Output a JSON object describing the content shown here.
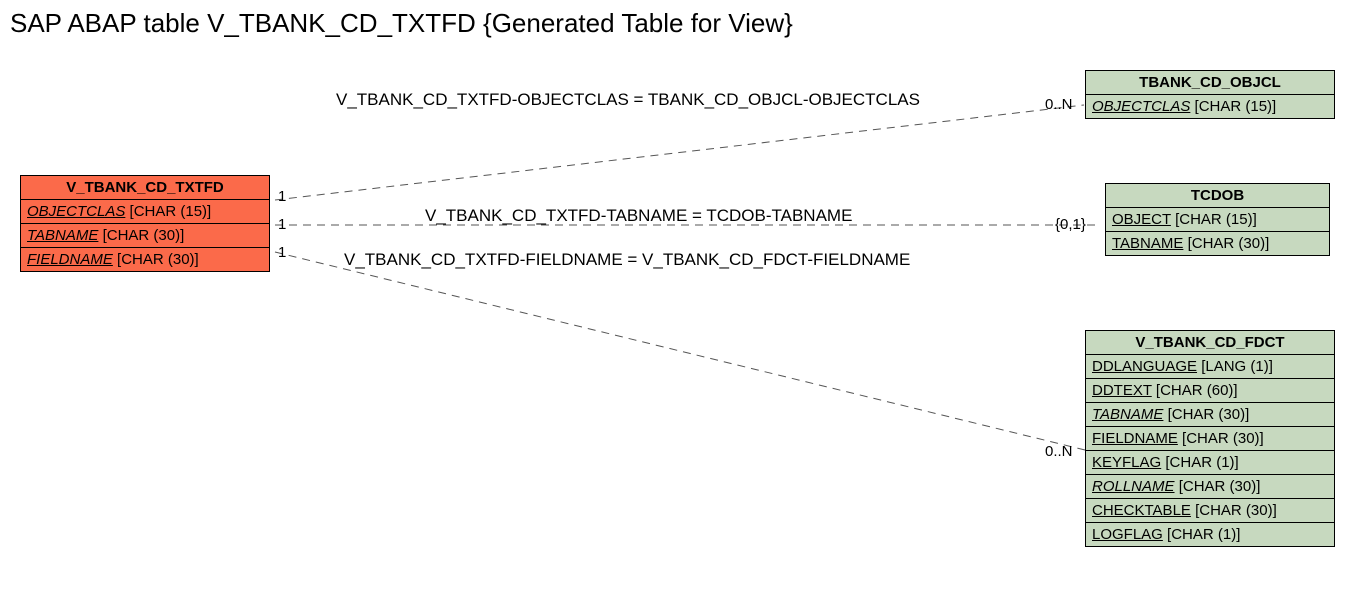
{
  "title": "SAP ABAP table V_TBANK_CD_TXTFD {Generated Table for View}",
  "main": {
    "name": "V_TBANK_CD_TXTFD",
    "fields": [
      {
        "label": "OBJECTCLAS",
        "type": "[CHAR (15)]",
        "italic": true
      },
      {
        "label": "TABNAME",
        "type": "[CHAR (30)]",
        "italic": true
      },
      {
        "label": "FIELDNAME",
        "type": "[CHAR (30)]",
        "italic": true
      }
    ]
  },
  "ref1": {
    "name": "TBANK_CD_OBJCL",
    "fields": [
      {
        "label": "OBJECTCLAS",
        "type": "[CHAR (15)]",
        "italic": true
      }
    ]
  },
  "ref2": {
    "name": "TCDOB",
    "fields": [
      {
        "label": "OBJECT",
        "type": "[CHAR (15)]",
        "italic": false
      },
      {
        "label": "TABNAME",
        "type": "[CHAR (30)]",
        "italic": false
      }
    ]
  },
  "ref3": {
    "name": "V_TBANK_CD_FDCT",
    "fields": [
      {
        "label": "DDLANGUAGE",
        "type": "[LANG (1)]",
        "italic": false
      },
      {
        "label": "DDTEXT",
        "type": "[CHAR (60)]",
        "italic": false
      },
      {
        "label": "TABNAME",
        "type": "[CHAR (30)]",
        "italic": true
      },
      {
        "label": "FIELDNAME",
        "type": "[CHAR (30)]",
        "italic": false
      },
      {
        "label": "KEYFLAG",
        "type": "[CHAR (1)]",
        "italic": false
      },
      {
        "label": "ROLLNAME",
        "type": "[CHAR (30)]",
        "italic": true
      },
      {
        "label": "CHECKTABLE",
        "type": "[CHAR (30)]",
        "italic": false
      },
      {
        "label": "LOGFLAG",
        "type": "[CHAR (1)]",
        "italic": false
      }
    ]
  },
  "rel1": {
    "text": "V_TBANK_CD_TXTFD-OBJECTCLAS = TBANK_CD_OBJCL-OBJECTCLAS",
    "left": "1",
    "right": "0..N"
  },
  "rel2": {
    "text": "V_TBANK_CD_TXTFD-TABNAME = TCDOB-TABNAME",
    "left": "1",
    "right": "{0,1}"
  },
  "rel3": {
    "text": "V_TBANK_CD_TXTFD-FIELDNAME = V_TBANK_CD_FDCT-FIELDNAME",
    "left": "1",
    "right": "0..N"
  }
}
